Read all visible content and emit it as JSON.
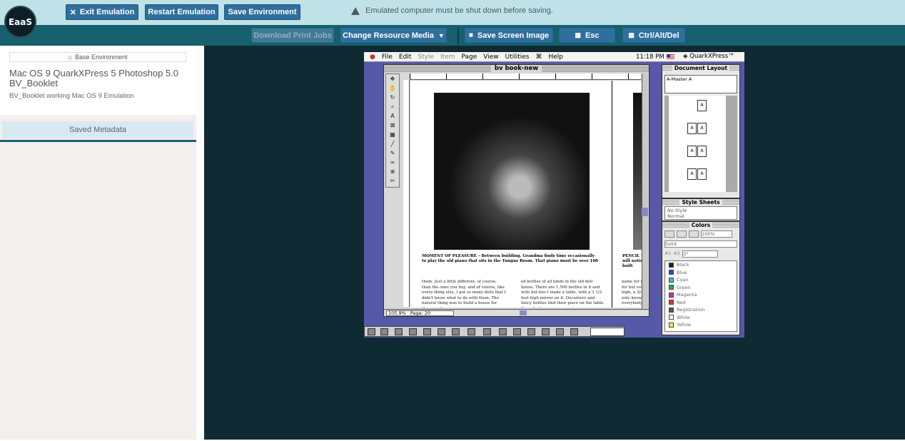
{
  "app": {
    "logo_text": "EaaS"
  },
  "toolbar": {
    "exit_label": "Exit Emulation",
    "restart_label": "Restart Emulation",
    "save_env_label": "Save Environment",
    "warning_text": "Emulated computer must be shut down before saving."
  },
  "toolbar2": {
    "download_label": "Download Print Jobs",
    "change_media_label": "Change Resource Media",
    "screen_image_label": "Save Screen Image",
    "esc_label": "Esc",
    "ctrl_alt_del_label": "Ctrl/Alt/Del"
  },
  "sidebar": {
    "chip_label": "Base Environment",
    "title": "Mac OS 9 QuarkXPress 5 Photoshop 5.0 BV_Booklet",
    "description": "BV_Booklet working Mac OS 9 Emulation",
    "metadata_tab": "Saved Metadata"
  },
  "mac": {
    "menu": [
      "File",
      "Edit",
      "Style",
      "Item",
      "Page",
      "View",
      "Utilities",
      "Help"
    ],
    "menu_disabled": [
      "Style",
      "Item"
    ],
    "clock": "11:18 PM",
    "app_name": "QuarkXPress™",
    "doc_title": "bv book-new",
    "zoom": "105.9%",
    "page_label": "Page: 20",
    "caption_line1": "MOMENT OF PLEASURE – Between building, Grandma finds time occasionally",
    "caption_line2": "to play the old piano     that sits in the Tungus Room.     That piano must be over 100",
    "body_col1": "them. Just a little different, of course, than the ones you buy, and of course, like every-thing else, I got so many dolls that I didn't know what to do with them. The natural thing was to build a house for them, and",
    "body_col2": "ed bottles of all kinds in the old doll house. There are 1,500 bottles in it and with bot-tles I made a table, with a 3 1/2 foot high mirror on it. Decanters and fancy bottles find their place on the table. If you look",
    "body_col3": "name for it, no one for but everybody do high, a 3/4' wide an only knows but in everybody talks abou",
    "caption_right": "PENCIL HOUS you will notice house, built",
    "layout_title": "Document Layout",
    "master_label": "A-Master A",
    "style_sheets_title": "Style Sheets",
    "style_sheets": [
      "No Style",
      "Normal"
    ],
    "colors_title": "Colors",
    "tint_value": "100%",
    "fill_type": "Solid",
    "angle_value": "0°",
    "radio1": "#1",
    "radio2": "#2",
    "colors": [
      {
        "name": "Black",
        "hex": "#222222"
      },
      {
        "name": "Blue",
        "hex": "#3344cc"
      },
      {
        "name": "Cyan",
        "hex": "#33bbdd"
      },
      {
        "name": "Green",
        "hex": "#33aa44"
      },
      {
        "name": "Magenta",
        "hex": "#cc3399"
      },
      {
        "name": "Red",
        "hex": "#dd3333"
      },
      {
        "name": "Registration",
        "hex": "#555555"
      },
      {
        "name": "White",
        "hex": "#ffffff"
      },
      {
        "name": "Yellow",
        "hex": "#eeee33"
      }
    ]
  }
}
